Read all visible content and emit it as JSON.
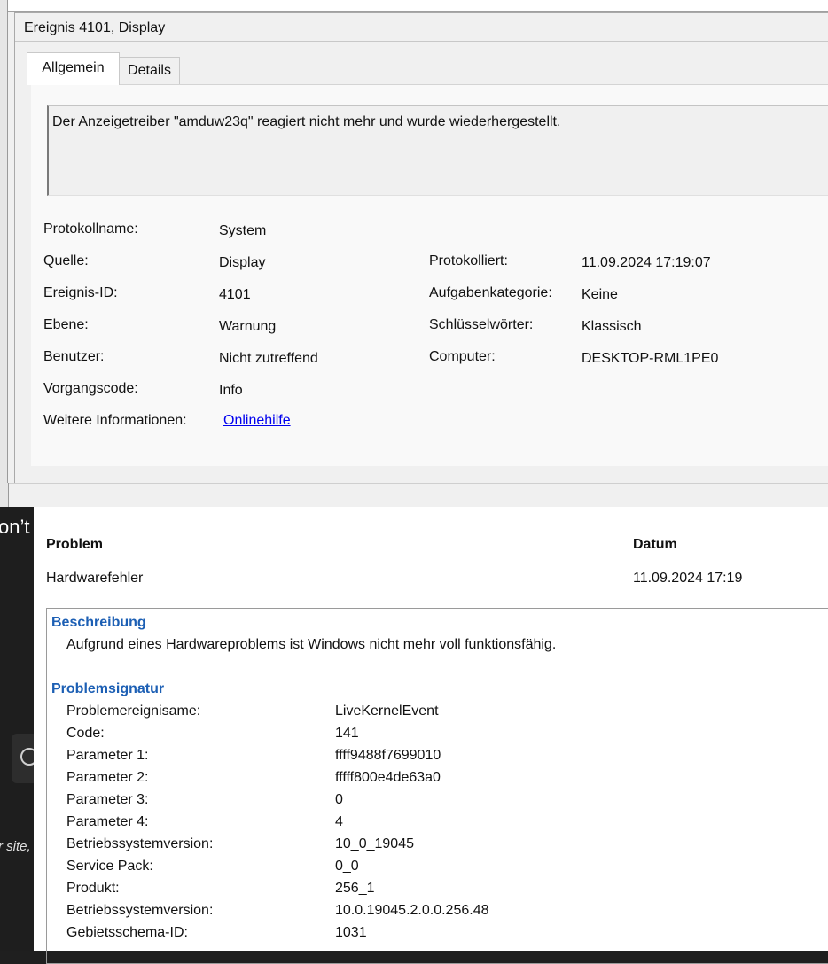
{
  "event_viewer": {
    "title": "Ereignis 4101, Display",
    "tabs": [
      "Allgemein",
      "Details"
    ],
    "description": "Der Anzeigetreiber \"amduw23q\" reagiert nicht mehr und wurde wiederhergestellt.",
    "fields": {
      "log_name_label": "Protokollname:",
      "log_name": "System",
      "source_label": "Quelle:",
      "source": "Display",
      "logged_label": "Protokolliert:",
      "logged": "11.09.2024 17:19:07",
      "event_id_label": "Ereignis-ID:",
      "event_id": "4101",
      "task_category_label": "Aufgabenkategorie:",
      "task_category": "Keine",
      "level_label": "Ebene:",
      "level": "Warnung",
      "keywords_label": "Schlüsselwörter:",
      "keywords": "Klassisch",
      "user_label": "Benutzer:",
      "user": "Nicht zutreffend",
      "computer_label": "Computer:",
      "computer": "DESKTOP-RML1PE0",
      "opcode_label": "Vorgangscode:",
      "opcode": "Info",
      "more_info_label": "Weitere Informationen:",
      "more_info_link": "Onlinehilfe"
    }
  },
  "background_site": {
    "text_top": "on’t",
    "text_mid": "r site,"
  },
  "reliability": {
    "col_problem": "Problem",
    "col_date": "Datum",
    "problem": "Hardwarefehler",
    "date": "11.09.2024 17:19",
    "description_title": "Beschreibung",
    "description": "Aufgrund eines Hardwareproblems ist Windows nicht mehr voll funktionsfähig.",
    "signature_title": "Problemsignatur",
    "signature": [
      {
        "name": "Problemereignisame:",
        "value": "LiveKernelEvent"
      },
      {
        "name": "Code:",
        "value": "141"
      },
      {
        "name": "Parameter 1:",
        "value": "ffff9488f7699010"
      },
      {
        "name": "Parameter 2:",
        "value": "fffff800e4de63a0"
      },
      {
        "name": "Parameter 3:",
        "value": "0"
      },
      {
        "name": "Parameter 4:",
        "value": "4"
      },
      {
        "name": "Betriebssystemversion:",
        "value": "10_0_19045"
      },
      {
        "name": "Service Pack:",
        "value": "0_0"
      },
      {
        "name": "Produkt:",
        "value": "256_1"
      },
      {
        "name": "Betriebssystemversion:",
        "value": "10.0.19045.2.0.0.256.48"
      },
      {
        "name": "Gebietsschema-ID:",
        "value": "1031"
      }
    ]
  }
}
